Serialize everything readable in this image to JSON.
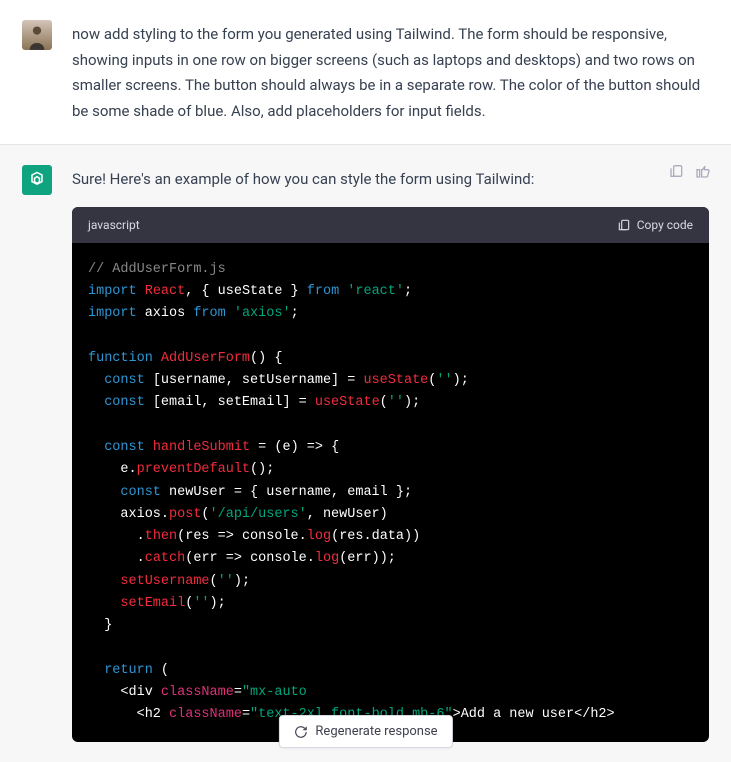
{
  "user_message": {
    "text": "now add styling to the form you generated using Tailwind. The form should be responsive, showing inputs in one row on bigger screens (such as laptops and desktops) and two rows on smaller screens. The button should always be in a separate row. The color of the button should be some shade of blue. Also, add placeholders for input fields."
  },
  "ai_message": {
    "intro": "Sure! Here's an example of how you can style the form using Tailwind:",
    "code_lang": "javascript",
    "copy_label": "Copy code",
    "code_tokens": [
      [
        {
          "t": "// AddUserForm.js",
          "c": "comment"
        }
      ],
      [
        {
          "t": "import",
          "c": "keyword"
        },
        {
          "t": " ",
          "c": "default"
        },
        {
          "t": "React",
          "c": "function"
        },
        {
          "t": ", { ",
          "c": "default"
        },
        {
          "t": "useState",
          "c": "default"
        },
        {
          "t": " } ",
          "c": "default"
        },
        {
          "t": "from",
          "c": "keyword"
        },
        {
          "t": " ",
          "c": "default"
        },
        {
          "t": "'react'",
          "c": "string"
        },
        {
          "t": ";",
          "c": "default"
        }
      ],
      [
        {
          "t": "import",
          "c": "keyword"
        },
        {
          "t": " axios ",
          "c": "default"
        },
        {
          "t": "from",
          "c": "keyword"
        },
        {
          "t": " ",
          "c": "default"
        },
        {
          "t": "'axios'",
          "c": "string"
        },
        {
          "t": ";",
          "c": "default"
        }
      ],
      [],
      [
        {
          "t": "function",
          "c": "keyword"
        },
        {
          "t": " ",
          "c": "default"
        },
        {
          "t": "AddUserForm",
          "c": "function"
        },
        {
          "t": "(",
          "c": "default"
        },
        {
          "t": ") {",
          "c": "default"
        }
      ],
      [
        {
          "t": "  ",
          "c": "default"
        },
        {
          "t": "const",
          "c": "keyword"
        },
        {
          "t": " [username, setUsername] = ",
          "c": "default"
        },
        {
          "t": "useState",
          "c": "function"
        },
        {
          "t": "(",
          "c": "default"
        },
        {
          "t": "''",
          "c": "string"
        },
        {
          "t": ");",
          "c": "default"
        }
      ],
      [
        {
          "t": "  ",
          "c": "default"
        },
        {
          "t": "const",
          "c": "keyword"
        },
        {
          "t": " [email, setEmail] = ",
          "c": "default"
        },
        {
          "t": "useState",
          "c": "function"
        },
        {
          "t": "(",
          "c": "default"
        },
        {
          "t": "''",
          "c": "string"
        },
        {
          "t": ");",
          "c": "default"
        }
      ],
      [],
      [
        {
          "t": "  ",
          "c": "default"
        },
        {
          "t": "const",
          "c": "keyword"
        },
        {
          "t": " ",
          "c": "default"
        },
        {
          "t": "handleSubmit",
          "c": "function"
        },
        {
          "t": " = (",
          "c": "default"
        },
        {
          "t": "e",
          "c": "default"
        },
        {
          "t": ") => {",
          "c": "default"
        }
      ],
      [
        {
          "t": "    e.",
          "c": "default"
        },
        {
          "t": "preventDefault",
          "c": "function"
        },
        {
          "t": "();",
          "c": "default"
        }
      ],
      [
        {
          "t": "    ",
          "c": "default"
        },
        {
          "t": "const",
          "c": "keyword"
        },
        {
          "t": " newUser = { username, email };",
          "c": "default"
        }
      ],
      [
        {
          "t": "    axios.",
          "c": "default"
        },
        {
          "t": "post",
          "c": "function"
        },
        {
          "t": "(",
          "c": "default"
        },
        {
          "t": "'/api/users'",
          "c": "string"
        },
        {
          "t": ", newUser)",
          "c": "default"
        }
      ],
      [
        {
          "t": "      .",
          "c": "default"
        },
        {
          "t": "then",
          "c": "function"
        },
        {
          "t": "(",
          "c": "default"
        },
        {
          "t": "res => ",
          "c": "default"
        },
        {
          "t": "console",
          "c": "default"
        },
        {
          "t": ".",
          "c": "default"
        },
        {
          "t": "log",
          "c": "function"
        },
        {
          "t": "(res.data))",
          "c": "default"
        }
      ],
      [
        {
          "t": "      .",
          "c": "default"
        },
        {
          "t": "catch",
          "c": "function"
        },
        {
          "t": "(",
          "c": "default"
        },
        {
          "t": "err => ",
          "c": "default"
        },
        {
          "t": "console",
          "c": "default"
        },
        {
          "t": ".",
          "c": "default"
        },
        {
          "t": "log",
          "c": "function"
        },
        {
          "t": "(err));",
          "c": "default"
        }
      ],
      [
        {
          "t": "    ",
          "c": "default"
        },
        {
          "t": "setUsername",
          "c": "function"
        },
        {
          "t": "(",
          "c": "default"
        },
        {
          "t": "''",
          "c": "string"
        },
        {
          "t": ");",
          "c": "default"
        }
      ],
      [
        {
          "t": "    ",
          "c": "default"
        },
        {
          "t": "setEmail",
          "c": "function"
        },
        {
          "t": "(",
          "c": "default"
        },
        {
          "t": "''",
          "c": "string"
        },
        {
          "t": ");",
          "c": "default"
        }
      ],
      [
        {
          "t": "  }",
          "c": "default"
        }
      ],
      [],
      [
        {
          "t": "  ",
          "c": "default"
        },
        {
          "t": "return",
          "c": "keyword"
        },
        {
          "t": " (",
          "c": "default"
        }
      ],
      [
        {
          "t": "    <div ",
          "c": "default"
        },
        {
          "t": "className",
          "c": "variable"
        },
        {
          "t": "=",
          "c": "default"
        },
        {
          "t": "\"mx-auto",
          "c": "string"
        }
      ],
      [
        {
          "t": "      <h2 ",
          "c": "default"
        },
        {
          "t": "className",
          "c": "variable"
        },
        {
          "t": "=",
          "c": "default"
        },
        {
          "t": "\"text-2xl font-bold mb-6\"",
          "c": "string"
        },
        {
          "t": ">Add a new user</h2>",
          "c": "default"
        }
      ]
    ]
  },
  "regenerate_label": "Regenerate response"
}
